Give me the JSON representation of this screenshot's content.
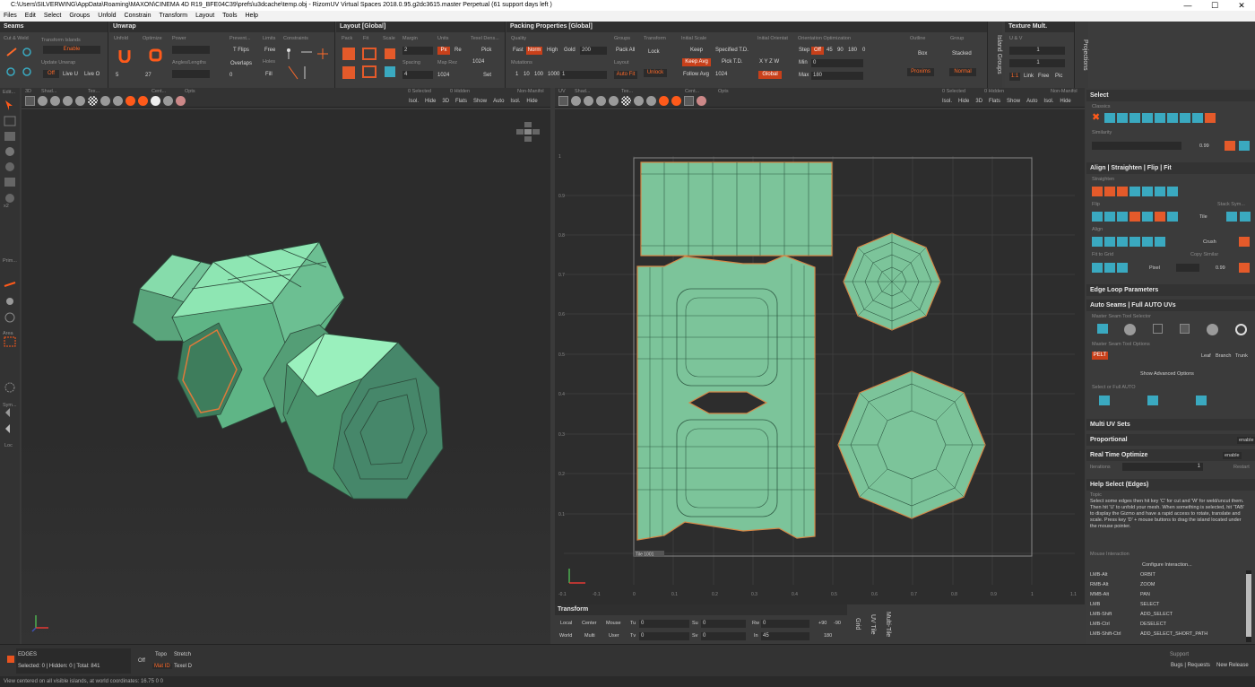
{
  "titlebar": {
    "title": "C:\\Users\\SILVERWING\\AppData\\Roaming\\MAXON\\CINEMA 4D R19_BFE04C39\\prefs\\u3dcache\\temp.obj - RizomUV  Virtual Spaces 2018.0.95.g2dc3615.master Perpetual  (61 support days left )"
  },
  "menu": [
    "Files",
    "Edit",
    "Select",
    "Groups",
    "Unfold",
    "Constrain",
    "Transform",
    "Layout",
    "Tools",
    "Help"
  ],
  "seams": {
    "title": "Seams",
    "cut_weld": "Cut & Weld",
    "transform_islands": "Transform Islands",
    "enable": "Enable",
    "update_unwrap": "Update Unwrap",
    "off": "Off",
    "live_u": "Live U",
    "live_o": "Live O"
  },
  "unwrap": {
    "title": "Unwrap",
    "unfold": "Unfold",
    "optimize": "Optimize",
    "power": "Power",
    "prevent": "Prevent...",
    "limits": "Limits",
    "constraints": "Constraints",
    "tflips": "T Flips",
    "free": "Free",
    "overlaps": "Overlaps",
    "holes": "Holes",
    "fill": "Fill",
    "angles_lengths": "Angles/Lengths",
    "v5": "5",
    "v27": "27",
    "v0": "0"
  },
  "layout": {
    "title": "Layout [Global]",
    "pack": "Pack",
    "fit": "Fit",
    "scale": "Scale",
    "margin": "Margin",
    "units": "Units",
    "texel": "Texel Dens...",
    "margin_v": "2",
    "px": "Px",
    "re": "Re",
    "pick": "Pick",
    "spacing": "Spacing",
    "spacing_v": "4",
    "map_res": "Map Rez",
    "map_v1": "1024",
    "map_v2": "1024",
    "set": "Set"
  },
  "packing": {
    "title": "Packing Properties [Global]",
    "quality": "Quality",
    "fast": "Fast",
    "norm": "Norm",
    "high": "High",
    "gold": "Gold",
    "gold_v": "200",
    "mutations": "Mutations",
    "m1": "1",
    "m10": "10",
    "m100": "100",
    "m1000": "1000",
    "m_v": "1",
    "groups": "Groups",
    "pack_all": "Pack All",
    "layout": "Layout",
    "auto_fit": "Auto Fit",
    "transform": "Transform",
    "lock": "Lock",
    "unlock": "Unlock",
    "initial_scale": "Initial Scale",
    "keep": "Keep",
    "specified": "Specified T.D.",
    "keep_avg": "Keep Avg",
    "pick_td": "Pick T.D.",
    "follow_avg": "Follow Avg",
    "f1024": "1024",
    "initial_orient": "Initial Orientat",
    "xyz": "X  Y  Z  W",
    "global": "Global",
    "orient_opt": "Orientation Optimization",
    "step": "Step",
    "off": "Off",
    "a45": "45",
    "a90": "90",
    "a180": "180",
    "a0": "0",
    "min": "Min",
    "max": "Max",
    "min_v": "0",
    "max_v": "180",
    "outline": "Outline",
    "box": "Box",
    "group": "Group",
    "stacked": "Stacked",
    "proxims": "Proxims",
    "normal": "Normal"
  },
  "side_tabs": {
    "island_groups": "Island Groups",
    "projections": "Projections",
    "grid": "Grid",
    "uv_tile": "UV Tile",
    "multi_tile": "Multi-Tile"
  },
  "texture_mult": {
    "title": "Texture Mult.",
    "uv": "U & V",
    "v1": "1",
    "v2": "1",
    "ratio": "1:1",
    "link": "Link",
    "free": "Free",
    "pic": "Pic"
  },
  "vp3d": {
    "headers": [
      "3D",
      "Shad...",
      "Tex...",
      "Cent...",
      "Opts",
      "0 Selected",
      "0 Hidden",
      "Non-Manifol"
    ],
    "right_btns": [
      "Isol.",
      "Hide",
      "3D",
      "Flats",
      "Show",
      "Auto",
      "Isol.",
      "Hide"
    ]
  },
  "vpuv": {
    "headers": [
      "UV",
      "Shad...",
      "Tex...",
      "Cent...",
      "Opts",
      "0 Selected",
      "0 Hidden",
      "Non-Manifol"
    ],
    "right_btns": [
      "Isol.",
      "Hide",
      "3D",
      "Flats",
      "Show",
      "Auto",
      "Isol.",
      "Hide"
    ],
    "tile_label": "Tile 1001",
    "y_ticks": [
      "1",
      "0.9",
      "0.8",
      "0.7",
      "0.6",
      "0.5",
      "0.4",
      "0.3",
      "0.2",
      "0.1"
    ],
    "x_ticks": [
      "-0.1",
      "0",
      "0.1",
      "0.2",
      "0.3",
      "0.4",
      "0.5",
      "0.6",
      "0.7",
      "0.8",
      "0.9",
      "1",
      "1.1"
    ]
  },
  "left_tools": {
    "edit": "Edit...",
    "x2": "x2",
    "prim": "Prim...",
    "area": "Area",
    "sym": "Sym...",
    "loc": "Loc"
  },
  "right": {
    "select": "Select",
    "classics": "Classics",
    "similarity": "Similarity",
    "sim_v": "0.99",
    "align": "Align | Straighten | Flip | Fit",
    "straighten": "Straighten",
    "flip": "Flip",
    "tile": "Tile",
    "stack_sym": "Stack Sym...",
    "align_lbl": "Align",
    "crush": "Crush",
    "fit_grid": "Fit to Grid",
    "copy_similar": "Copy Similar",
    "pixel": "Pixel",
    "pix_v": "0.99",
    "edge_loop": "Edge Loop Parameters",
    "auto_seams": "Auto Seams | Full AUTO UVs",
    "master_sel": "Master Seam Tool Selector",
    "master_opt": "Master Seam Tool Options",
    "pelt": "PELT",
    "leaf": "Leaf",
    "branch": "Branch",
    "trunk": "Trunk",
    "show_adv": "Show Advanced Options",
    "select_full": "Select or Full AUTO",
    "multi_uv": "Multi UV Sets",
    "proportional": "Proportional",
    "enable": "enable",
    "realtime": "Real Time Optimize",
    "rt_enable": "enable",
    "iterations": "Iterations",
    "iter_v": "1",
    "restart": "Restart",
    "help": "Help Select (Edges)",
    "topic": "Topic",
    "help_text": "Select some edges then hit key 'C' for cut and 'W' for weld/uncut them. Then hit 'U' to unfold your mesh. When something is selected, hit 'TAB' to display the Gizmo and have a rapid access to rotate, translate and scale. Press key 'D' + mouse buttons to drag the island located under the mouse pointer.",
    "mouse_inter": "Mouse Interaction",
    "configure": "Configure Interaction...",
    "bindings": [
      [
        "LMB-Alt",
        "ORBIT"
      ],
      [
        "RMB-Alt",
        "ZOOM"
      ],
      [
        "MMB-Alt",
        "PAN"
      ],
      [
        "LMB",
        "SELECT"
      ],
      [
        "LMB-Shift",
        "ADD_SELECT"
      ],
      [
        "LMB-Ctrl",
        "DESELECT"
      ],
      [
        "LMB-Shift-Ctrl",
        "ADD_SELECT_SHORT_PATH"
      ]
    ]
  },
  "transform": {
    "title": "Transform",
    "local": "Local",
    "center": "Center",
    "mouse": "Mouse",
    "tu": "Tu",
    "tu_v": "0",
    "su": "Su",
    "su_v": "0",
    "rw": "Rw",
    "rw_v": "0",
    "p90": "+90",
    "m90": "-90",
    "world": "World",
    "multi": "Multi",
    "user": "User",
    "tv": "Tv",
    "tv_v": "0",
    "sv": "Sv",
    "sv_v": "0",
    "in": "In",
    "in_v": "45",
    "v180": "180"
  },
  "bottom": {
    "mode": "EDGES",
    "counts": "Selected: 0 | Hidden: 0 | Total: 841",
    "off": "Off",
    "topo": "Topo",
    "stretch": "Stretch",
    "mat_id": "Mat ID",
    "texel_d": "Texel D",
    "support": "Support",
    "bugs": "Bugs | Requests",
    "new_release": "New Release"
  },
  "status": {
    "text": "View centered on all visible islands, at world coordinates: 16.75 0 0"
  },
  "colors": {
    "accent": "#e8531f",
    "mesh": "#7cc49a",
    "bg": "#2d2d2d"
  }
}
